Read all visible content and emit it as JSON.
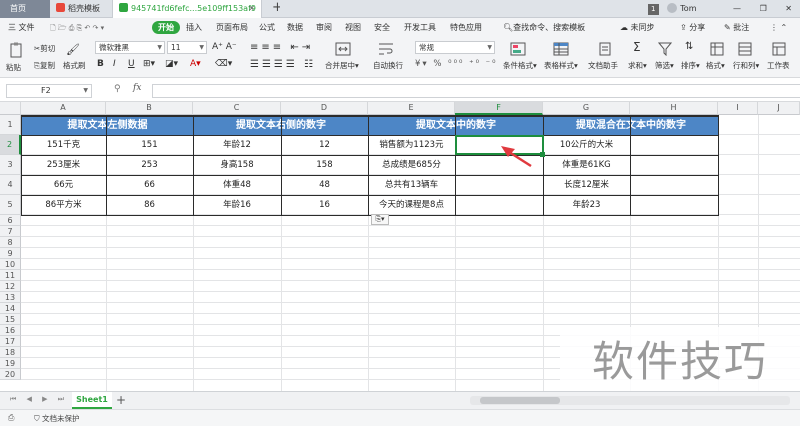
{
  "titlebar": {
    "tab_home": "首页",
    "tab_template": "稻壳模板",
    "tab_file": "945741fd6fefc...5e109ff153af9",
    "tab_add": "+",
    "badge": "1",
    "user": "Tom"
  },
  "menubar": {
    "file": "三 文件",
    "start": "开始",
    "items": [
      "插入",
      "页面布局",
      "公式",
      "数据",
      "审阅",
      "视图",
      "安全",
      "开发工具",
      "特色应用"
    ],
    "search": "查找命令、搜索模板",
    "sync": "未同步",
    "share": "分享",
    "comment": "批注"
  },
  "ribbon": {
    "paste": "粘贴",
    "cut": "剪切",
    "copy": "复制",
    "format_painter": "格式刷",
    "font_name": "微软雅黑",
    "font_size": "11",
    "merge_center": "合并居中",
    "wrap": "自动换行",
    "number_format": "常规",
    "conditional": "条件格式",
    "table_style": "表格样式",
    "doc_helper": "文档助手",
    "sum": "求和",
    "filter": "筛选",
    "sort": "排序",
    "format": "格式",
    "rowcol": "行和列",
    "worksheet": "工作表"
  },
  "formula_bar": {
    "cell_ref": "F2",
    "fx": "fx",
    "value": ""
  },
  "columns": [
    "A",
    "B",
    "C",
    "D",
    "E",
    "F",
    "G",
    "H",
    "I",
    "J"
  ],
  "rows": [
    "1",
    "2",
    "3",
    "4",
    "5",
    "6",
    "7",
    "8",
    "9",
    "10",
    "11",
    "12",
    "13",
    "14",
    "15",
    "16",
    "17",
    "18",
    "19",
    "20"
  ],
  "table": {
    "headers": [
      "提取文本左侧数据",
      "提取文本右侧的数字",
      "提取文本中的数字",
      "提取混合在文本中的数字"
    ],
    "rows": [
      [
        "151千克",
        "151",
        "年龄12",
        "12",
        "销售额为1123元",
        "",
        "10公斤的大米",
        ""
      ],
      [
        "253厘米",
        "253",
        "身高158",
        "158",
        "总成绩是685分",
        "",
        "体重是61KG",
        ""
      ],
      [
        "66元",
        "66",
        "体重48",
        "48",
        "总共有13辆车",
        "",
        "长度12厘米",
        ""
      ],
      [
        "86平方米",
        "86",
        "年龄16",
        "16",
        "今天的课程是8点",
        "",
        "年龄23",
        ""
      ]
    ]
  },
  "sheets": {
    "active": "Sheet1",
    "add": "+"
  },
  "status": {
    "protect": "文档未保护"
  },
  "watermark": "软件技巧",
  "colors": {
    "header_fill": "#4d86c6",
    "accent_green": "#2fa640",
    "selection": "#1e8e3e",
    "arrow": "#e0393e"
  }
}
